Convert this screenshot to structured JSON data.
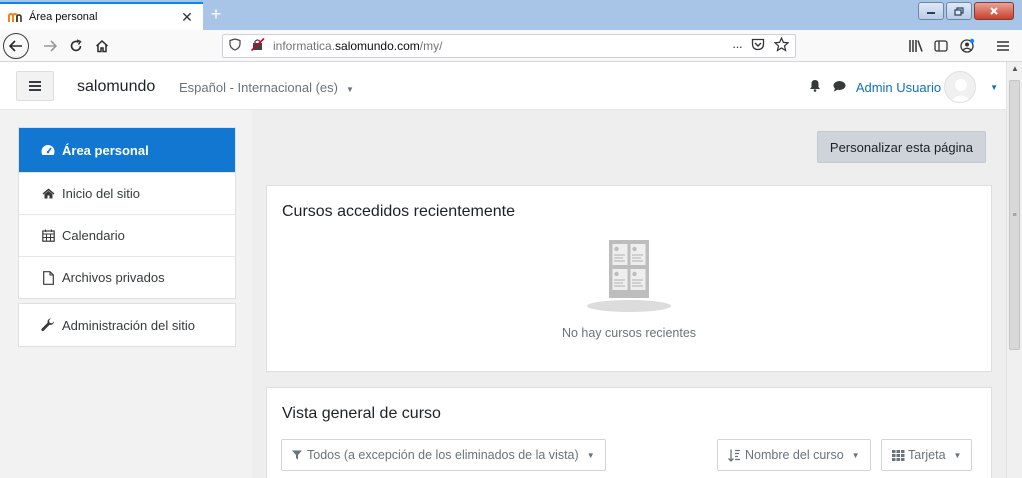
{
  "browser": {
    "tab_title": "Área personal",
    "url_prefix": "informatica.",
    "url_domain": "salomundo.com",
    "url_path": "/my/",
    "more_glyph": "···"
  },
  "navbar": {
    "brand": "salomundo",
    "language": "Español - Internacional (es)",
    "user_name": "Admin Usuario"
  },
  "sidebar": {
    "items": [
      {
        "label": "Área personal",
        "icon": "dashboard-icon"
      },
      {
        "label": "Inicio del sitio",
        "icon": "home-icon"
      },
      {
        "label": "Calendario",
        "icon": "calendar-icon"
      },
      {
        "label": "Archivos privados",
        "icon": "file-icon"
      }
    ],
    "admin": {
      "label": "Administración del sitio",
      "icon": "wrench-icon"
    }
  },
  "main": {
    "customize_label": "Personalizar esta página",
    "recent": {
      "title": "Cursos accedidos recientemente",
      "empty_text": "No hay cursos recientes"
    },
    "course_overview": {
      "title": "Vista general de curso",
      "filter_label": "Todos (a excepción de los eliminados de la vista)",
      "sort_label": "Nombre del curso",
      "view_label": "Tarjeta"
    }
  },
  "colors": {
    "accent": "#1177d1",
    "link": "#0f6fc5",
    "page_bg": "#f2f2f2"
  }
}
